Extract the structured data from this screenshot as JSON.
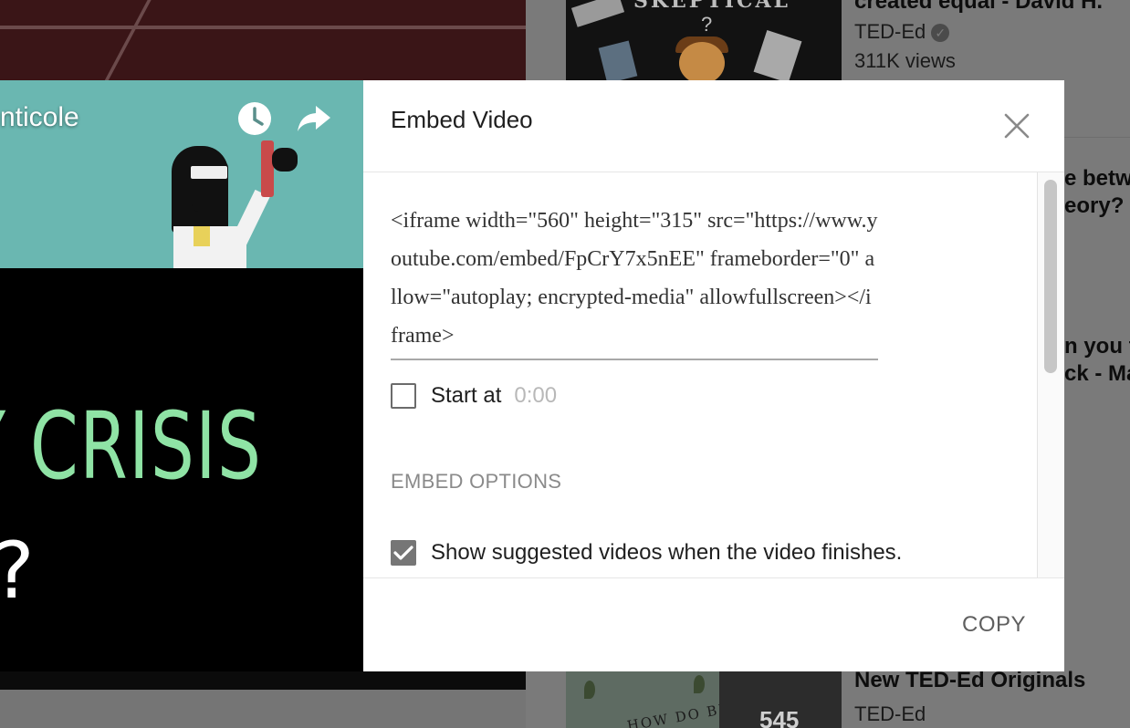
{
  "background": {
    "sidebar_items": [
      {
        "title": "created equal - David H.",
        "channel": "TED-Ed",
        "verified": true,
        "views": "311K views"
      },
      {
        "title_fragment_1": "e betw",
        "title_fragment_2": "eory? -"
      },
      {
        "title_fragment_1": "n you f",
        "title_fragment_2": "ck - Ma"
      },
      {
        "title": "New TED-Ed Originals",
        "channel": "TED-Ed",
        "count": "545"
      }
    ],
    "thumbnail_text": {
      "skeptical": "SKEPTICAL",
      "question": "?",
      "birds": "HOW DO BIRDS"
    }
  },
  "video": {
    "title_fragment": "nticole",
    "overlay_word": "Y CRISIS",
    "overlay_mark": "?",
    "icons": [
      "watch-later-icon",
      "share-icon"
    ]
  },
  "dialog": {
    "title": "Embed Video",
    "embed_code": "<iframe width=\"560\" height=\"315\" src=\"https://www.youtube.com/embed/FpCrY7x5nEE\" frameborder=\"0\" allow=\"autoplay; encrypted-media\" allowfullscreen></iframe>",
    "start_at": {
      "label": "Start at",
      "value": "0:00",
      "checked": false
    },
    "section_heading": "EMBED OPTIONS",
    "options": [
      {
        "label": "Show suggested videos when the video finishes.",
        "checked": true
      }
    ],
    "copy_label": "COPY"
  },
  "colors": {
    "overlay_dim": "#757575",
    "checkbox_checked": "#767676",
    "crisis_text": "#8fe3a5"
  }
}
